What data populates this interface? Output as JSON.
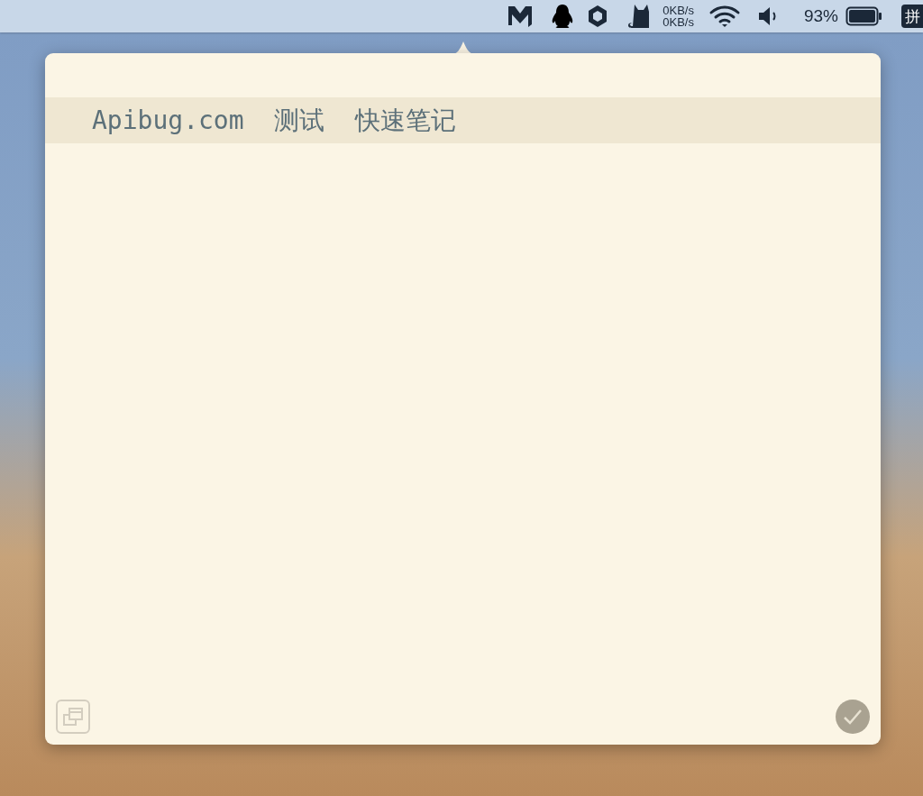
{
  "menu_bar": {
    "network_speed": {
      "upload": "0KB/s",
      "download": "0KB/s"
    },
    "battery": {
      "percent": "93%"
    },
    "input_method": "拼"
  },
  "note": {
    "lines": [
      {
        "text": "Apibug.com  测试  快速笔记",
        "current": true
      }
    ]
  }
}
